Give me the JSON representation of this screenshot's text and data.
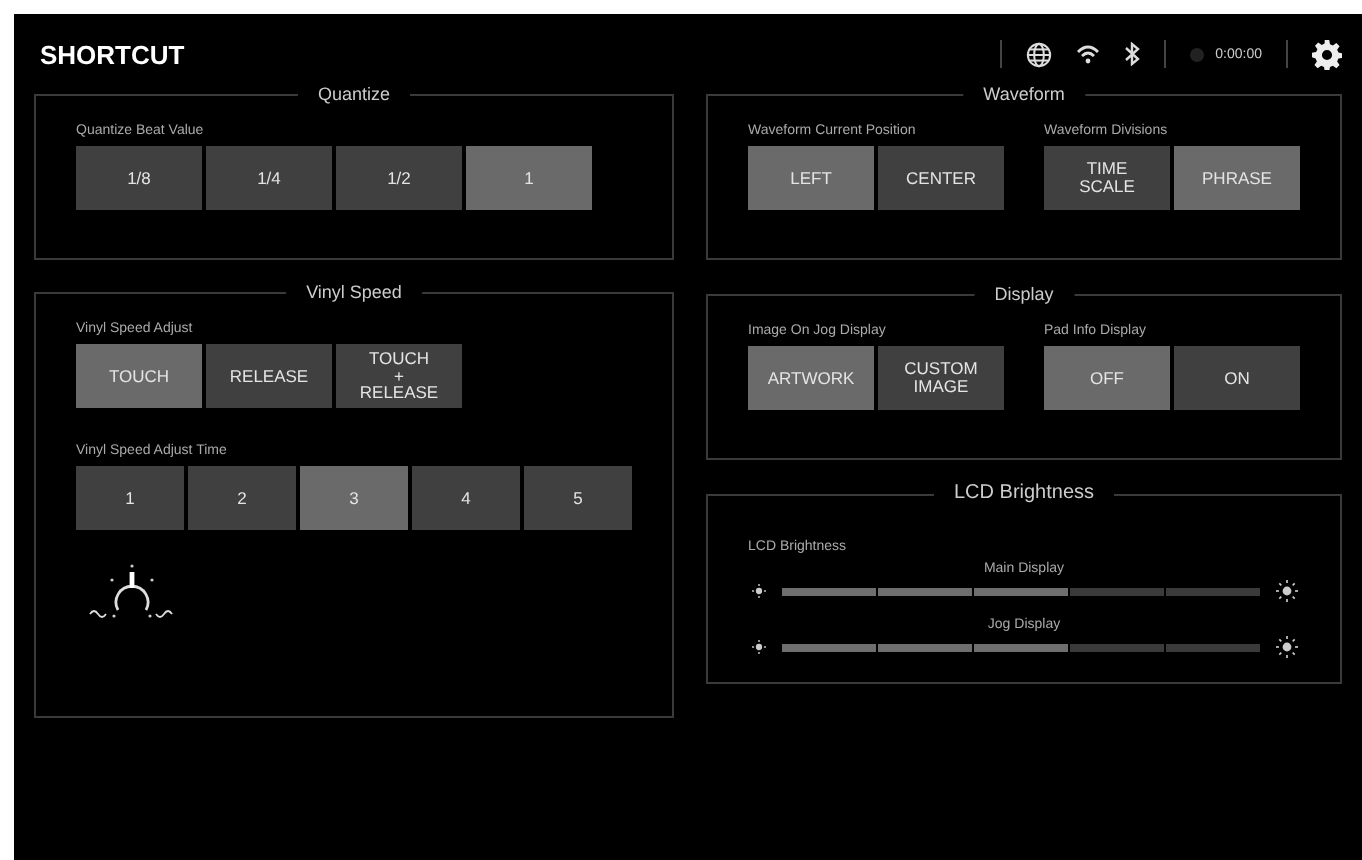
{
  "header": {
    "title": "SHORTCUT",
    "time": "0:00:00"
  },
  "left_column": [
    {
      "kind": "buttons",
      "title": "Quantize",
      "knob_icon": false,
      "groups": [
        {
          "label": "Quantize Beat Value",
          "options": [
            {
              "label": "1/8",
              "selected": false
            },
            {
              "label": "1/4",
              "selected": false
            },
            {
              "label": "1/2",
              "selected": false
            },
            {
              "label": "1",
              "selected": true
            }
          ]
        }
      ]
    },
    {
      "kind": "buttons",
      "title": "Vinyl Speed",
      "knob_icon": true,
      "groups": [
        {
          "label": "Vinyl Speed Adjust",
          "options": [
            {
              "label": "TOUCH",
              "selected": true
            },
            {
              "label": "RELEASE",
              "selected": false
            },
            {
              "label": "TOUCH\n+\nRELEASE",
              "selected": false
            }
          ]
        },
        {
          "label": "Vinyl Speed Adjust Time",
          "options": [
            {
              "label": "1",
              "selected": false
            },
            {
              "label": "2",
              "selected": false
            },
            {
              "label": "3",
              "selected": true
            },
            {
              "label": "4",
              "selected": false
            },
            {
              "label": "5",
              "selected": false
            }
          ]
        }
      ]
    }
  ],
  "right_column": [
    {
      "kind": "buttons",
      "title": "Waveform",
      "knob_icon": false,
      "groups": [
        {
          "label": "Waveform Current Position",
          "options": [
            {
              "label": "LEFT",
              "selected": true
            },
            {
              "label": "CENTER",
              "selected": false
            }
          ]
        },
        {
          "label": "Waveform Divisions",
          "options": [
            {
              "label": "TIME\nSCALE",
              "selected": false
            },
            {
              "label": "PHRASE",
              "selected": true
            }
          ]
        }
      ]
    },
    {
      "kind": "buttons",
      "title": "Display",
      "knob_icon": false,
      "groups": [
        {
          "label": "Image On Jog Display",
          "options": [
            {
              "label": "ARTWORK",
              "selected": true
            },
            {
              "label": "CUSTOM\nIMAGE",
              "selected": false
            }
          ]
        },
        {
          "label": "Pad Info Display",
          "options": [
            {
              "label": "OFF",
              "selected": true
            },
            {
              "label": "ON",
              "selected": false
            }
          ]
        }
      ]
    },
    {
      "kind": "sliders",
      "title": "LCD Brightness",
      "caption": "LCD Brightness",
      "sliders": [
        {
          "label": "Main Display",
          "level": 0.6
        },
        {
          "label": "Jog Display",
          "level": 0.6
        }
      ]
    }
  ]
}
